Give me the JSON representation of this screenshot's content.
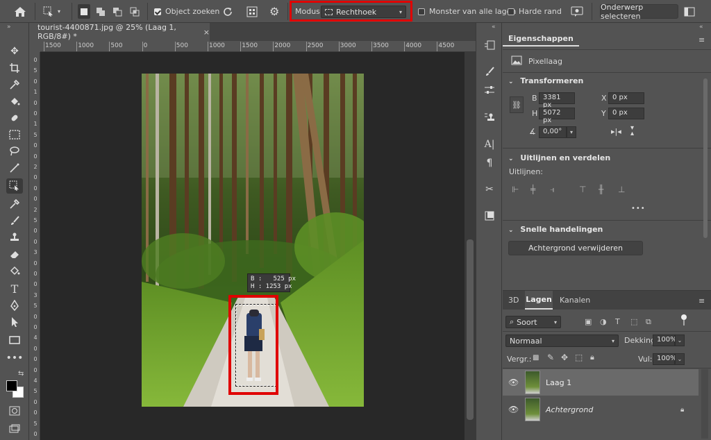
{
  "options_bar": {
    "object_finder_label": "Object zoeken",
    "mode_label": "Modus:",
    "mode_value": "Rechthoek",
    "sample_all_label": "Monster van alle lagen",
    "hard_edge_label": "Harde rand",
    "select_subject_label": "Onderwerp selecteren",
    "highlight_color": "#e00000"
  },
  "document": {
    "tab_title": "tourist-4400871.jpg @ 25% (Laag 1, RGB/8#) *",
    "ruler_h": [
      "1500",
      "1000",
      "500",
      "0",
      "500",
      "1000",
      "1500",
      "2000",
      "2500",
      "3000",
      "3500",
      "4000",
      "4500"
    ],
    "ruler_v": [
      "0",
      "5",
      "0",
      "1",
      "0",
      "0",
      "1",
      "5",
      "0",
      "0",
      "2",
      "0",
      "0",
      "0",
      "2",
      "5",
      "0",
      "0",
      "3",
      "0",
      "0",
      "0",
      "3",
      "5",
      "0",
      "0",
      "4",
      "0",
      "0",
      "0",
      "4",
      "5",
      "0",
      "0",
      "5",
      "0"
    ],
    "tooltip_b": "B :   525 px",
    "tooltip_h": "H : 1253 px"
  },
  "properties": {
    "tab_label": "Eigenschappen",
    "layer_type": "Pixellaag",
    "transform_title": "Transformeren",
    "b_label": "B",
    "b_value": "3381 px",
    "h_label": "H",
    "h_value": "5072 px",
    "x_label": "X",
    "x_value": "0 px",
    "y_label": "Y",
    "y_value": "0 px",
    "angle_value": "0,00°",
    "align_title": "Uitlijnen en verdelen",
    "align_label": "Uitlijnen:",
    "more_label": "•••",
    "quick_title": "Snelle handelingen",
    "remove_bg_label": "Achtergrond verwijderen"
  },
  "layers": {
    "tabs": [
      "3D",
      "Lagen",
      "Kanalen"
    ],
    "filter_label": "Soort",
    "blend_mode": "Normaal",
    "opacity_label": "Dekking:",
    "opacity_value": "100%",
    "lock_label": "Vergr.:",
    "fill_label": "Vul:",
    "fill_value": "100%",
    "items": [
      {
        "name": "Laag 1",
        "selected": true
      },
      {
        "name": "Achtergrond",
        "selected": false
      }
    ]
  }
}
